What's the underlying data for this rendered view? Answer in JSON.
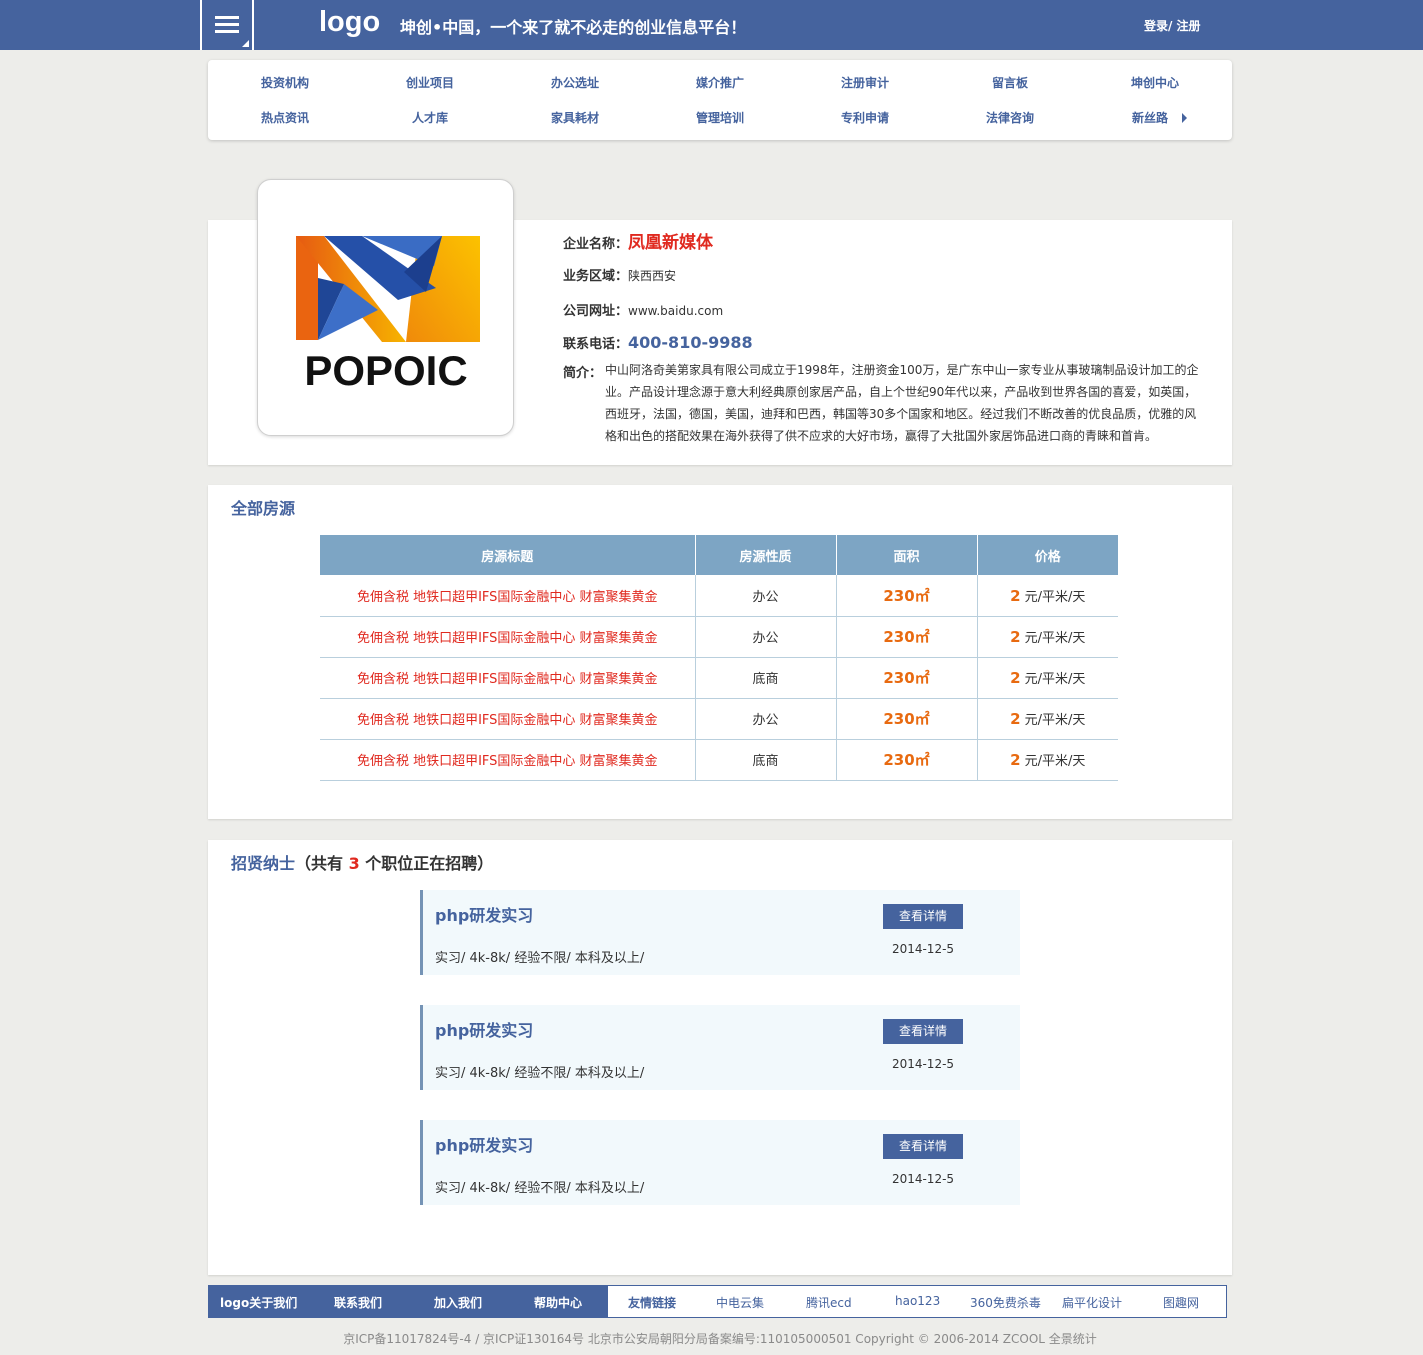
{
  "header": {
    "logo": "logo",
    "slogan": "坤创•中国，一个来了就不必走的创业信息平台！",
    "auth": "登录/ 注册"
  },
  "nav": {
    "row1": [
      "投资机构",
      "创业项目",
      "办公选址",
      "媒介推广",
      "注册审计",
      "留言板",
      "坤创中心"
    ],
    "row2": [
      "热点资讯",
      "人才库",
      "家具耗材",
      "管理培训",
      "专利申请",
      "法律咨询",
      "新丝路"
    ]
  },
  "company": {
    "logo_text": "POPOIC",
    "name_label": "企业名称：",
    "name": "凤凰新媒体",
    "region_label": "业务区域：",
    "region": "陕西西安",
    "website_label": "公司网址：",
    "website": "www.baidu.com",
    "phone_label": "联系电话：",
    "phone": "400-810-9988",
    "intro_label": "简介：",
    "intro": "中山阿洛奇美第家具有限公司成立于1998年，注册资金100万，是广东中山一家专业从事玻璃制品设计加工的企业。产品设计理念源于意大利经典原创家居产品，自上个世纪90年代以来，产品收到世界各国的喜爱，如英国，西班牙，法国，德国，美国，迪拜和巴西，韩国等30多个国家和地区。经过我们不断改善的优良品质，优雅的风格和出色的搭配效果在海外获得了供不应求的大好市场，赢得了大批国外家居饰品进口商的青睐和首肯。"
  },
  "listings": {
    "title": "全部房源",
    "headers": [
      "房源标题",
      "房源性质",
      "面积",
      "价格"
    ],
    "rows": [
      {
        "title": "免佣含税 地铁口超甲IFS国际金融中心 财富聚集黄金",
        "type": "办公",
        "area": "230㎡",
        "price": "2",
        "unit": " 元/平米/天"
      },
      {
        "title": "免佣含税 地铁口超甲IFS国际金融中心 财富聚集黄金",
        "type": "办公",
        "area": "230㎡",
        "price": "2",
        "unit": " 元/平米/天"
      },
      {
        "title": "免佣含税 地铁口超甲IFS国际金融中心 财富聚集黄金",
        "type": "底商",
        "area": "230㎡",
        "price": "2",
        "unit": " 元/平米/天"
      },
      {
        "title": "免佣含税 地铁口超甲IFS国际金融中心 财富聚集黄金",
        "type": "办公",
        "area": "230㎡",
        "price": "2",
        "unit": " 元/平米/天"
      },
      {
        "title": "免佣含税 地铁口超甲IFS国际金融中心 财富聚集黄金",
        "type": "底商",
        "area": "230㎡",
        "price": "2",
        "unit": " 元/平米/天"
      }
    ]
  },
  "jobs": {
    "title": "招贤纳士",
    "count_prefix": "（共有 ",
    "count": "3",
    "count_suffix": " 个职位正在招聘）",
    "items": [
      {
        "title": "php研发实习",
        "meta": "实习/ 4k-8k/ 经验不限/ 本科及以上/",
        "button": "查看详情",
        "date": "2014-12-5"
      },
      {
        "title": "php研发实习",
        "meta": "实习/ 4k-8k/ 经验不限/ 本科及以上/",
        "button": "查看详情",
        "date": "2014-12-5"
      },
      {
        "title": "php研发实习",
        "meta": "实习/ 4k-8k/ 经验不限/ 本科及以上/",
        "button": "查看详情",
        "date": "2014-12-5"
      }
    ]
  },
  "footer": {
    "main_links": [
      "logo关于我们",
      "联系我们",
      "加入我们",
      "帮助中心"
    ],
    "friend_label": "友情链接",
    "friend_links": [
      "中电云集",
      "腾讯ecd",
      "hao123",
      "360免费杀毒",
      "扁平化设计",
      "图趣网"
    ],
    "copyright": "京ICP备11017824号-4 / 京ICP证130164号 北京市公安局朝阳分局备案编号:110105000501 Copyright © 2006-2014 ZCOOL 全景统计"
  },
  "colors": {
    "brand_blue": "#45639e",
    "table_header": "#7da5c4",
    "accent_red": "#e0291f",
    "accent_orange": "#e86a10"
  }
}
